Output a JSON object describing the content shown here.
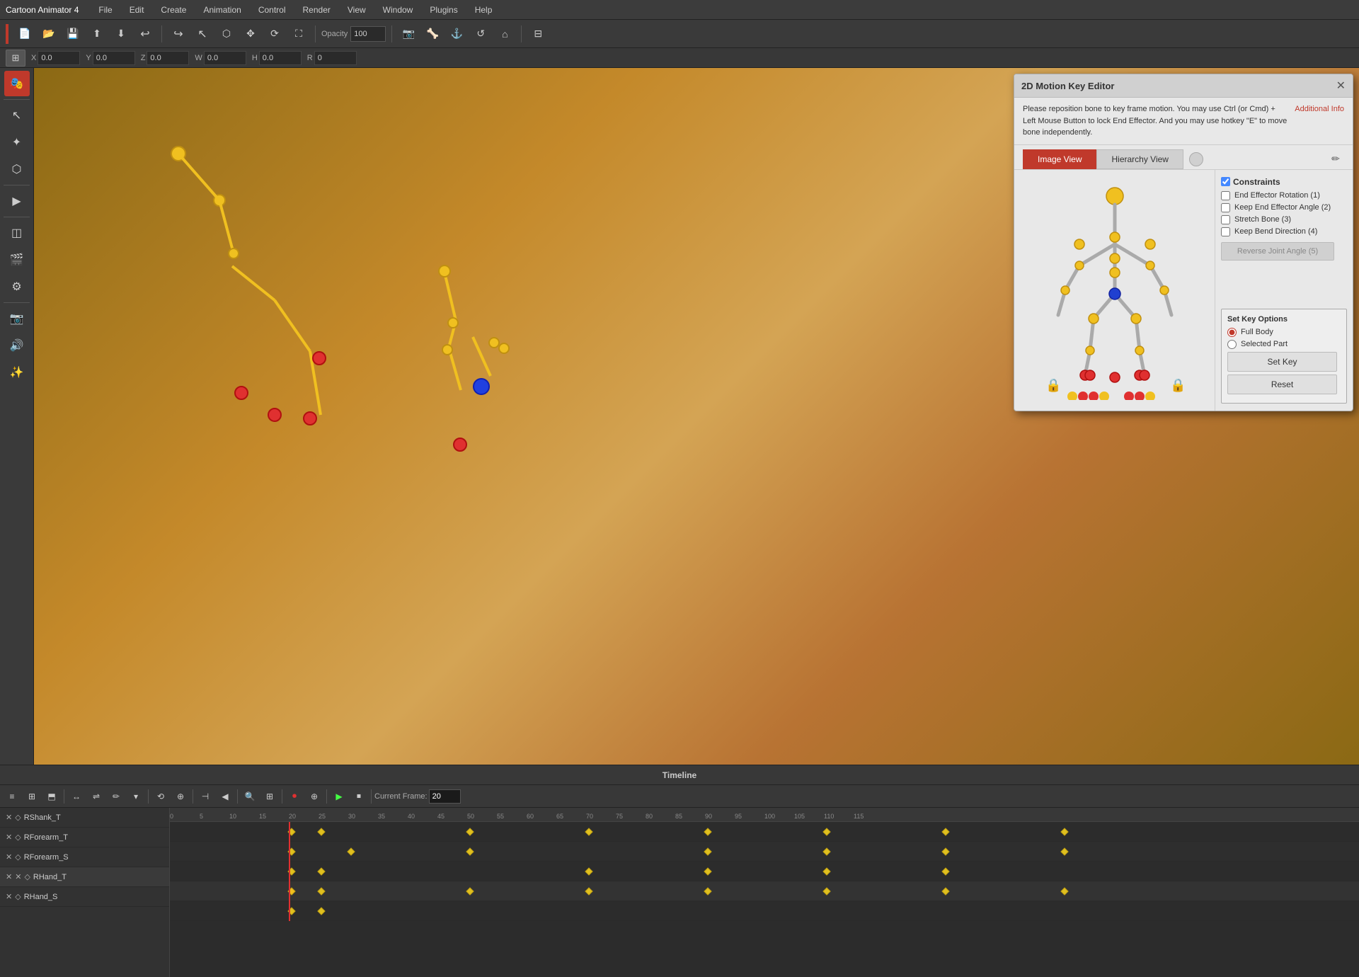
{
  "app": {
    "title": "Cartoon Animator 4"
  },
  "menubar": {
    "items": [
      "File",
      "Edit",
      "Create",
      "Animation",
      "Control",
      "Render",
      "View",
      "Window",
      "Plugins",
      "Help"
    ]
  },
  "toolbar": {
    "opacity_label": "Opacity",
    "opacity_value": "100"
  },
  "coordsbar": {
    "x_label": "X",
    "x_value": "0.0",
    "y_label": "Y",
    "y_value": "0.0",
    "z_label": "Z",
    "z_value": "0.0",
    "w_label": "W",
    "w_value": "0.0",
    "h_label": "H",
    "h_value": "0.0",
    "r_label": "R",
    "r_value": "0"
  },
  "motion_editor": {
    "title": "2D Motion Key Editor",
    "info_text": "Please reposition bone to key frame motion. You may use Ctrl (or Cmd) + Left Mouse Button to lock End Effector. And you may use hotkey \"E\" to move bone independently.",
    "additional_info": "Additional Info",
    "tab_image": "Image View",
    "tab_hierarchy": "Hierarchy View"
  },
  "constraints": {
    "header": "Constraints",
    "items": [
      {
        "label": "End Effector Rotation (1)",
        "checked": false,
        "enabled": true
      },
      {
        "label": "Keep End Effector Angle (2)",
        "checked": false,
        "enabled": true
      },
      {
        "label": "Stretch Bone (3)",
        "checked": false,
        "enabled": true
      },
      {
        "label": "Keep Bend Direction (4)",
        "checked": false,
        "enabled": true
      }
    ],
    "reverse_btn": "Reverse Joint Angle (5)"
  },
  "set_key_options": {
    "header": "Set Key Options",
    "options": [
      {
        "label": "Full Body",
        "selected": true
      },
      {
        "label": "Selected Part",
        "selected": false
      }
    ],
    "set_key_btn": "Set Key",
    "reset_btn": "Reset"
  },
  "timeline": {
    "label": "Timeline",
    "current_frame_label": "Current Frame:",
    "current_frame_value": "20",
    "tracks": [
      {
        "name": "RShank_T"
      },
      {
        "name": "RForearm_T"
      },
      {
        "name": "RForearm_S"
      },
      {
        "name": "RHand_T",
        "active": true
      },
      {
        "name": "RHand_S"
      }
    ],
    "ruler_ticks": [
      0,
      5,
      10,
      15,
      20,
      25,
      30,
      35,
      40,
      45,
      50,
      55,
      60,
      65,
      70,
      75,
      80,
      85,
      90,
      95,
      100,
      105,
      110,
      115
    ]
  }
}
